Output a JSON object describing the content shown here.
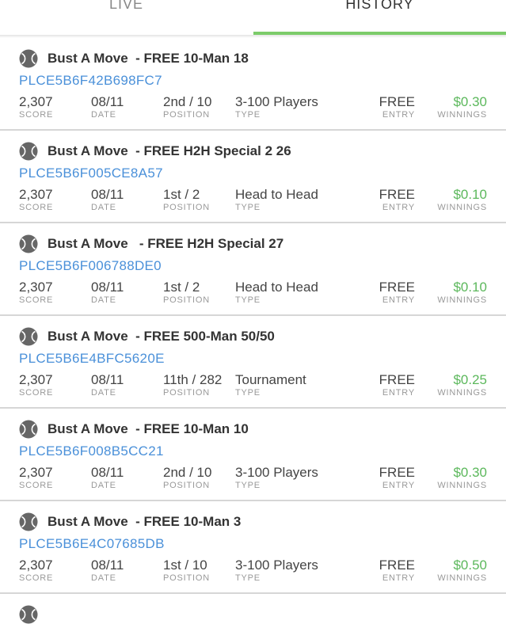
{
  "tabs": {
    "live": "LIVE",
    "history": "HISTORY",
    "active": "history"
  },
  "labels": {
    "score": "SCORE",
    "date": "DATE",
    "position": "POSITION",
    "type": "TYPE",
    "entry": "ENTRY",
    "winnings": "WINNINGS"
  },
  "colors": {
    "accent_green": "#7ccc6a",
    "winnings_green": "#5cb85c",
    "code_blue": "#4a90d9"
  },
  "contests": [
    {
      "title": "Bust A Move  - FREE 10-Man 18",
      "code": "PLCE5B6F42B698FC7",
      "score": "2,307",
      "date": "08/11",
      "position": "2nd / 10",
      "type": "3-100 Players",
      "entry": "FREE",
      "winnings": "$0.30",
      "icon": "tennis-ball-icon"
    },
    {
      "title": "Bust A Move  - FREE H2H Special 2 26",
      "code": "PLCE5B6F005CE8A57",
      "score": "2,307",
      "date": "08/11",
      "position": "1st / 2",
      "type": "Head to Head",
      "entry": "FREE",
      "winnings": "$0.10",
      "icon": "tennis-ball-icon"
    },
    {
      "title": "Bust A Move   - FREE H2H Special 27",
      "code": "PLCE5B6F006788DE0",
      "score": "2,307",
      "date": "08/11",
      "position": "1st / 2",
      "type": "Head to Head",
      "entry": "FREE",
      "winnings": "$0.10",
      "icon": "tennis-ball-icon"
    },
    {
      "title": "Bust A Move  - FREE 500-Man 50/50",
      "code": "PLCE5B6E4BFC5620E",
      "score": "2,307",
      "date": "08/11",
      "position": "11th / 282",
      "type": "Tournament",
      "entry": "FREE",
      "winnings": "$0.25",
      "icon": "tennis-ball-icon"
    },
    {
      "title": "Bust A Move  - FREE 10-Man 10",
      "code": "PLCE5B6F008B5CC21",
      "score": "2,307",
      "date": "08/11",
      "position": "2nd / 10",
      "type": "3-100 Players",
      "entry": "FREE",
      "winnings": "$0.30",
      "icon": "tennis-ball-icon"
    },
    {
      "title": "Bust A Move  - FREE 10-Man 3",
      "code": "PLCE5B6E4C07685DB",
      "score": "2,307",
      "date": "08/11",
      "position": "1st / 10",
      "type": "3-100 Players",
      "entry": "FREE",
      "winnings": "$0.50",
      "icon": "tennis-ball-icon"
    }
  ]
}
